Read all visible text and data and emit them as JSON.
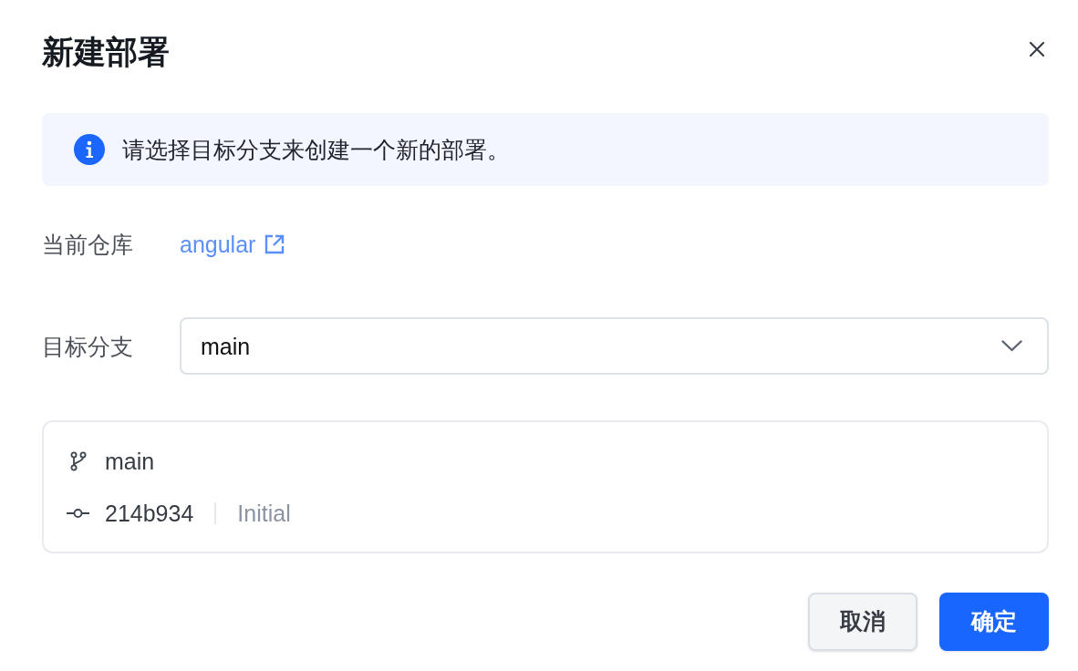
{
  "dialog": {
    "title": "新建部署"
  },
  "alert": {
    "kind": "info",
    "text": "请选择目标分支来创建一个新的部署。"
  },
  "fields": [
    {
      "kind": "link",
      "label": "当前仓库",
      "value": "angular"
    },
    {
      "kind": "select",
      "label": "目标分支",
      "value": "main"
    }
  ],
  "branch_card": {
    "branch": "main",
    "commit_hash": "214b934",
    "commit_message": "Initial"
  },
  "buttons": [
    {
      "kind": "secondary",
      "label": "取消"
    },
    {
      "kind": "primary",
      "label": "确定"
    }
  ]
}
